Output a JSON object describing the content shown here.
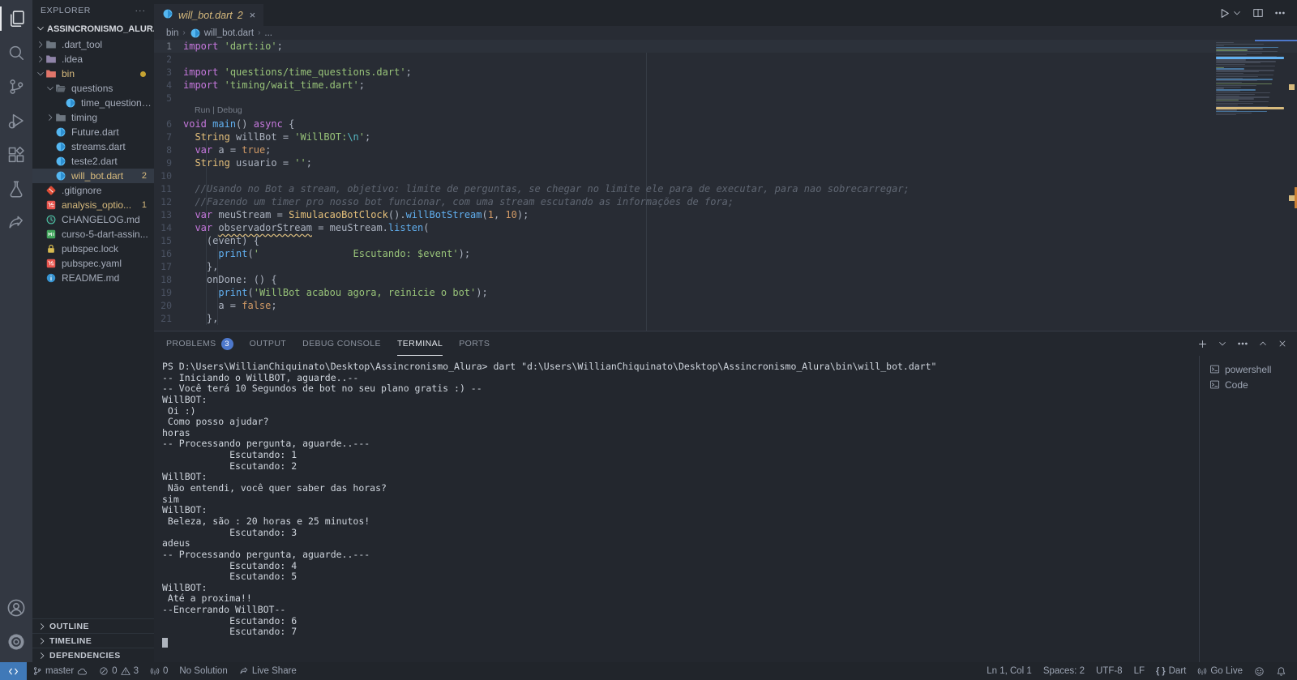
{
  "colors": {
    "accent_blue": "#4d78cc",
    "warning_yellow": "#d7ba7d",
    "status_remote_bg": "#4079b8",
    "editor_bg": "#282c34",
    "sidebar_bg": "#21252b",
    "activitybar_bg": "#333842",
    "string_green": "#98c379",
    "keyword_purple": "#c678dd",
    "class_yellow": "#e5c07b",
    "func_blue": "#61afef",
    "number_orange": "#d19a66",
    "comment_gray": "#5f6672"
  },
  "activity_bar": {
    "top": [
      {
        "name": "explorer",
        "active": true
      },
      {
        "name": "search"
      },
      {
        "name": "source-control"
      },
      {
        "name": "run-debug"
      },
      {
        "name": "extensions"
      },
      {
        "name": "testing"
      },
      {
        "name": "live-share"
      }
    ],
    "bottom": [
      {
        "name": "account"
      },
      {
        "name": "settings"
      }
    ]
  },
  "sidebar": {
    "header": "EXPLORER",
    "project": "ASSINCRONISMO_ALURA",
    "tree": [
      {
        "label": ".dart_tool",
        "indent": 1,
        "chevron": "right",
        "icon": "folder",
        "icon_color": "#6d7680"
      },
      {
        "label": ".idea",
        "indent": 1,
        "chevron": "right",
        "icon": "folder",
        "icon_color": "#8f84a8"
      },
      {
        "label": "bin",
        "indent": 1,
        "chevron": "down",
        "icon": "folder",
        "icon_color": "#e0756a",
        "label_color": "#d7ba7d",
        "dot": true
      },
      {
        "label": "questions",
        "indent": 2,
        "chevron": "down",
        "icon": "folder-open",
        "icon_color": "#6d7680"
      },
      {
        "label": "time_questions....",
        "indent": 3,
        "icon": "dart"
      },
      {
        "label": "timing",
        "indent": 2,
        "chevron": "right",
        "icon": "folder",
        "icon_color": "#6d7680"
      },
      {
        "label": "Future.dart",
        "indent": 2,
        "icon": "dart"
      },
      {
        "label": "streams.dart",
        "indent": 2,
        "icon": "dart"
      },
      {
        "label": "teste2.dart",
        "indent": 2,
        "icon": "dart"
      },
      {
        "label": "will_bot.dart",
        "indent": 2,
        "icon": "dart",
        "selected": true,
        "label_color": "#d7ba7d",
        "badge": "2"
      },
      {
        "label": ".gitignore",
        "indent": 1,
        "icon": "git"
      },
      {
        "label": "analysis_optio...",
        "indent": 1,
        "icon": "yaml",
        "label_color": "#d7ba7d",
        "badge": "1"
      },
      {
        "label": "CHANGELOG.md",
        "indent": 1,
        "icon": "clock"
      },
      {
        "label": "curso-5-dart-assin...",
        "indent": 1,
        "icon": "mdgreen"
      },
      {
        "label": "pubspec.lock",
        "indent": 1,
        "icon": "lock"
      },
      {
        "label": "pubspec.yaml",
        "indent": 1,
        "icon": "yaml"
      },
      {
        "label": "README.md",
        "indent": 1,
        "icon": "info"
      }
    ],
    "bottom_sections": [
      "OUTLINE",
      "TIMELINE",
      "DEPENDENCIES"
    ]
  },
  "tab": {
    "title": "will_bot.dart",
    "badge": "2",
    "close": "×"
  },
  "breadcrumb": [
    {
      "label": "bin"
    },
    {
      "label": "will_bot.dart",
      "icon": "dart"
    },
    {
      "label": "..."
    }
  ],
  "editor": {
    "lines": [
      {
        "n": 1,
        "cur": true,
        "t": [
          [
            "kw",
            "import"
          ],
          [
            "pl",
            " "
          ],
          [
            "st",
            "'dart:io'"
          ],
          [
            "pl",
            ";"
          ]
        ]
      },
      {
        "n": 2,
        "t": []
      },
      {
        "n": 3,
        "t": [
          [
            "kw",
            "import"
          ],
          [
            "pl",
            " "
          ],
          [
            "st",
            "'questions/time_questions.dart'"
          ],
          [
            "pl",
            ";"
          ]
        ]
      },
      {
        "n": 4,
        "t": [
          [
            "kw",
            "import"
          ],
          [
            "pl",
            " "
          ],
          [
            "st",
            "'timing/wait_time.dart'"
          ],
          [
            "pl",
            ";"
          ]
        ]
      },
      {
        "n": 5,
        "t": []
      },
      {
        "lens": "Run | Debug"
      },
      {
        "n": 6,
        "t": [
          [
            "kw",
            "void"
          ],
          [
            "pl",
            " "
          ],
          [
            "fn",
            "main"
          ],
          [
            "pl",
            "() "
          ],
          [
            "kw",
            "async"
          ],
          [
            "pl",
            " {"
          ]
        ]
      },
      {
        "n": 7,
        "t": [
          [
            "pl",
            "  "
          ],
          [
            "cl",
            "String"
          ],
          [
            "pl",
            " willBot = "
          ],
          [
            "st",
            "'WillBOT:"
          ],
          [
            "es",
            "\\n"
          ],
          [
            "st",
            "'"
          ],
          [
            "pl",
            ";"
          ]
        ]
      },
      {
        "n": 8,
        "t": [
          [
            "pl",
            "  "
          ],
          [
            "kw",
            "var"
          ],
          [
            "pl",
            " a = "
          ],
          [
            "nu",
            "true"
          ],
          [
            "pl",
            ";"
          ]
        ]
      },
      {
        "n": 9,
        "t": [
          [
            "pl",
            "  "
          ],
          [
            "cl",
            "String"
          ],
          [
            "pl",
            " usuario = "
          ],
          [
            "st",
            "''"
          ],
          [
            "pl",
            ";"
          ]
        ]
      },
      {
        "n": 10,
        "t": []
      },
      {
        "n": 11,
        "t": [
          [
            "cm",
            "  //Usando no Bot a stream, objetivo: limite de perguntas, se chegar no limite ele para de executar, para nao sobrecarregar;"
          ]
        ]
      },
      {
        "n": 12,
        "t": [
          [
            "cm",
            "  //Fazendo um timer pro nosso bot funcionar, com uma stream escutando as informações de fora;"
          ]
        ]
      },
      {
        "n": 13,
        "t": [
          [
            "pl",
            "  "
          ],
          [
            "kw",
            "var"
          ],
          [
            "pl",
            " meuStream = "
          ],
          [
            "cl",
            "SimulacaoBotClock"
          ],
          [
            "pl",
            "()."
          ],
          [
            "fn",
            "willBotStream"
          ],
          [
            "pl",
            "("
          ],
          [
            "nu",
            "1"
          ],
          [
            "pl",
            ", "
          ],
          [
            "nu",
            "10"
          ],
          [
            "pl",
            ");"
          ]
        ]
      },
      {
        "n": 14,
        "t": [
          [
            "pl",
            "  "
          ],
          [
            "kw",
            "var"
          ],
          [
            "pl",
            " "
          ],
          [
            "wa",
            "observadorStream"
          ],
          [
            "pl",
            " = meuStream."
          ],
          [
            "fn",
            "listen"
          ],
          [
            "pl",
            "("
          ]
        ]
      },
      {
        "n": 15,
        "t": [
          [
            "pl",
            "    (event) {"
          ]
        ]
      },
      {
        "n": 16,
        "t": [
          [
            "pl",
            "      "
          ],
          [
            "fn",
            "print"
          ],
          [
            "pl",
            "("
          ],
          [
            "st",
            "'                Escutando: $event'"
          ],
          [
            "pl",
            ");"
          ]
        ]
      },
      {
        "n": 17,
        "t": [
          [
            "pl",
            "    },"
          ]
        ]
      },
      {
        "n": 18,
        "t": [
          [
            "pl",
            "    onDone: () {"
          ]
        ]
      },
      {
        "n": 19,
        "t": [
          [
            "pl",
            "      "
          ],
          [
            "fn",
            "print"
          ],
          [
            "pl",
            "("
          ],
          [
            "st",
            "'WillBot acabou agora, reinicie o bot'"
          ],
          [
            "pl",
            ");"
          ]
        ]
      },
      {
        "n": 20,
        "t": [
          [
            "pl",
            "      a = "
          ],
          [
            "nu",
            "false"
          ],
          [
            "pl",
            ";"
          ]
        ]
      },
      {
        "n": 21,
        "t": [
          [
            "pl",
            "    },"
          ]
        ]
      }
    ]
  },
  "panel": {
    "tabs": [
      {
        "label": "PROBLEMS",
        "badge": "3"
      },
      {
        "label": "OUTPUT"
      },
      {
        "label": "DEBUG CONSOLE"
      },
      {
        "label": "TERMINAL",
        "active": true
      },
      {
        "label": "PORTS"
      }
    ],
    "actions": [
      {
        "name": "plus"
      },
      {
        "name": "chevron-down"
      },
      {
        "name": "more"
      },
      {
        "name": "chevron-up"
      },
      {
        "name": "close"
      }
    ],
    "terminal_lines": [
      "PS D:\\Users\\WillianChiquinato\\Desktop\\Assincronismo_Alura> dart \"d:\\Users\\WillianChiquinato\\Desktop\\Assincronismo_Alura\\bin\\will_bot.dart\"",
      "-- Iniciando o WillBOT, aguarde..--",
      "-- Você terá 10 Segundos de bot no seu plano gratis :) --",
      "WillBOT:",
      " Oi :)",
      " Como posso ajudar?",
      "horas",
      "-- Processando pergunta, aguarde..---",
      "            Escutando: 1",
      "            Escutando: 2",
      "WillBOT:",
      " Não entendi, você quer saber das horas?",
      "sim",
      "WillBOT:",
      " Beleza, são : 20 horas e 25 minutos!",
      "            Escutando: 3",
      "adeus",
      "-- Processando pergunta, aguarde..---",
      "            Escutando: 4",
      "            Escutando: 5",
      "WillBOT:",
      " Até a proxima!!",
      "--Encerrando WillBOT--",
      "            Escutando: 6",
      "            Escutando: 7"
    ],
    "cursor": true,
    "terminals": [
      {
        "icon": "terminal",
        "label": "powershell"
      },
      {
        "icon": "terminal",
        "label": "Code"
      }
    ]
  },
  "status_bar": {
    "left": [
      {
        "name": "remote-indicator",
        "accent": true,
        "parts": [
          {
            "icon": "remote"
          }
        ]
      },
      {
        "name": "git-branch",
        "parts": [
          {
            "icon": "branch"
          },
          {
            "text": "master"
          },
          {
            "icon": "cloud"
          }
        ]
      },
      {
        "name": "problems",
        "parts": [
          {
            "icon": "error"
          },
          {
            "text": "0"
          },
          {
            "icon": "warning"
          },
          {
            "text": "3"
          }
        ]
      },
      {
        "name": "ports",
        "parts": [
          {
            "icon": "antenna"
          },
          {
            "text": "0"
          }
        ]
      },
      {
        "name": "solution",
        "parts": [
          {
            "text": "No Solution"
          }
        ]
      },
      {
        "name": "live-share",
        "parts": [
          {
            "icon": "liveshare-small"
          },
          {
            "text": "Live Share"
          }
        ]
      }
    ],
    "right": [
      {
        "name": "cursor-position",
        "parts": [
          {
            "text": "Ln 1, Col 1"
          }
        ]
      },
      {
        "name": "indentation",
        "parts": [
          {
            "text": "Spaces: 2"
          }
        ]
      },
      {
        "name": "encoding",
        "parts": [
          {
            "text": "UTF-8"
          }
        ]
      },
      {
        "name": "eol",
        "parts": [
          {
            "text": "LF"
          }
        ]
      },
      {
        "name": "language-mode",
        "parts": [
          {
            "icon": "braces"
          },
          {
            "text": "Dart"
          }
        ]
      },
      {
        "name": "go-live",
        "parts": [
          {
            "icon": "antenna"
          },
          {
            "text": "Go Live"
          }
        ]
      },
      {
        "name": "feedback",
        "parts": [
          {
            "icon": "feedback"
          }
        ]
      },
      {
        "name": "notifications",
        "parts": [
          {
            "icon": "bell"
          }
        ]
      }
    ]
  }
}
